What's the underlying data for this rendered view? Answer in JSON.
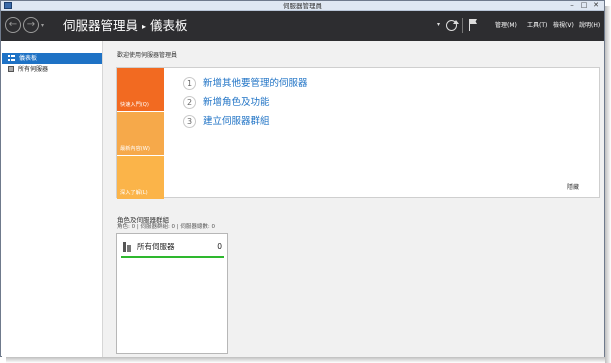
{
  "window": {
    "title": "伺服器管理員",
    "min_glyph": "–",
    "max_glyph": "□",
    "close_glyph": "✕"
  },
  "header": {
    "back_glyph": "←",
    "forward_glyph": "→",
    "drop_glyph": "▾",
    "breadcrumb_root": "伺服器管理員",
    "breadcrumb_sep": "▸",
    "breadcrumb_current": "儀表板",
    "menus": {
      "manage": "管理(M)",
      "tools": "工具(T)",
      "view": "檢視(V)",
      "help": "說明(H)"
    }
  },
  "sidebar": {
    "items": [
      {
        "label": "儀表板"
      },
      {
        "label": "所有伺服器"
      }
    ]
  },
  "welcome": {
    "heading": "歡迎使用伺服器管理員",
    "tiles": {
      "quick_start": "快速入門(Q)",
      "whats_new": "最新內容(W)",
      "learn_more": "深入了解(L)"
    },
    "steps": [
      {
        "num": "1",
        "label": "新增其他要管理的伺服器"
      },
      {
        "num": "2",
        "label": "新增角色及功能"
      },
      {
        "num": "3",
        "label": "建立伺服器群組"
      }
    ],
    "hide": "隱藏"
  },
  "roles": {
    "title": "角色及伺服器群組",
    "summary": "角色: 0 | 伺服器群組: 0 | 伺服器總數: 0",
    "tiles": [
      {
        "label": "所有伺服器",
        "count": "0"
      }
    ]
  },
  "colors": {
    "header_bg": "#2d2d30",
    "sidebar_active": "#1e72c5",
    "quick_start_tile": "#f26a21",
    "whats_new_tile": "#f6a94a",
    "learn_more_tile": "#fbb449",
    "status_bar": "#2eb82e",
    "link": "#1e72c5"
  }
}
